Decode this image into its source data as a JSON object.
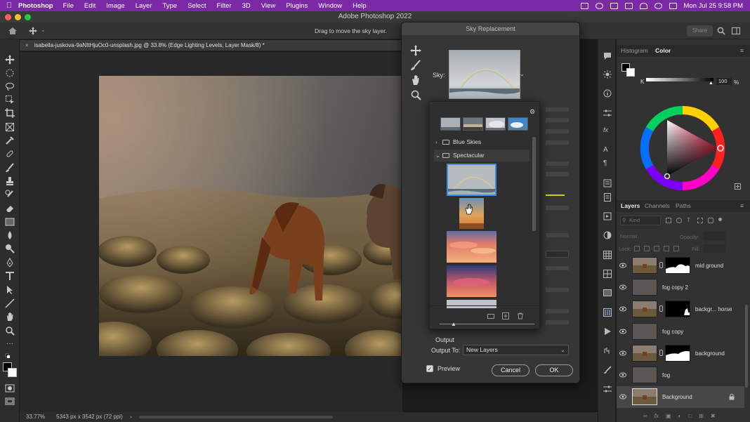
{
  "menubar": {
    "app": "Photoshop",
    "items": [
      "File",
      "Edit",
      "Image",
      "Layer",
      "Type",
      "Select",
      "Filter",
      "3D",
      "View",
      "Plugins",
      "Window",
      "Help"
    ],
    "clock": "Mon Jul 25  9:58 PM"
  },
  "window": {
    "title": "Adobe Photoshop 2022"
  },
  "options_bar": {
    "hint": "Drag to move the sky layer.",
    "share_label": "Share"
  },
  "document": {
    "tab_title": "isabella-juskova-9aNItHjuOc0-unsplash.jpg @ 33.8% (Edge Lighting Levels, Layer Mask/8) *",
    "zoom": "33.77%",
    "dimensions": "5343 px x 3542 px (72 ppi)"
  },
  "sky_dialog": {
    "title": "Sky Replacement",
    "sky_label": "Sky:",
    "folders": [
      {
        "name": "Blue Skies",
        "expanded": false
      },
      {
        "name": "Spectacular",
        "expanded": true
      }
    ],
    "output_heading": "Output",
    "output_to_label": "Output To:",
    "output_to_value": "New Layers",
    "preview_label": "Preview",
    "preview_checked": true,
    "cancel_label": "Cancel",
    "ok_label": "OK"
  },
  "panels": {
    "top_tabs": [
      "Histogram",
      "Color"
    ],
    "active_top_tab": "Color",
    "k_label": "K",
    "k_value": "100",
    "k_unit": "%",
    "layer_tabs": [
      "Layers",
      "Channels",
      "Paths"
    ],
    "active_layer_tab": "Layers",
    "filter_placeholder": "Kind",
    "blend_mode": "Normal",
    "opacity_label": "Opacity:",
    "lock_label": "Lock:",
    "fill_label": "Fill:",
    "layers": [
      {
        "name": "mid ground",
        "has_mask": true
      },
      {
        "name": "fog copy 2",
        "has_mask": false
      },
      {
        "name": "backgr... horse",
        "has_mask": true
      },
      {
        "name": "fog copy",
        "has_mask": false
      },
      {
        "name": "background",
        "has_mask": true
      },
      {
        "name": "fog",
        "has_mask": false
      },
      {
        "name": "Background",
        "has_mask": false,
        "locked": true,
        "selected": true
      }
    ]
  },
  "colors": {
    "menubar": "#7a2aa6",
    "ui_bg": "#323232",
    "accent": "#e0e0e0"
  }
}
